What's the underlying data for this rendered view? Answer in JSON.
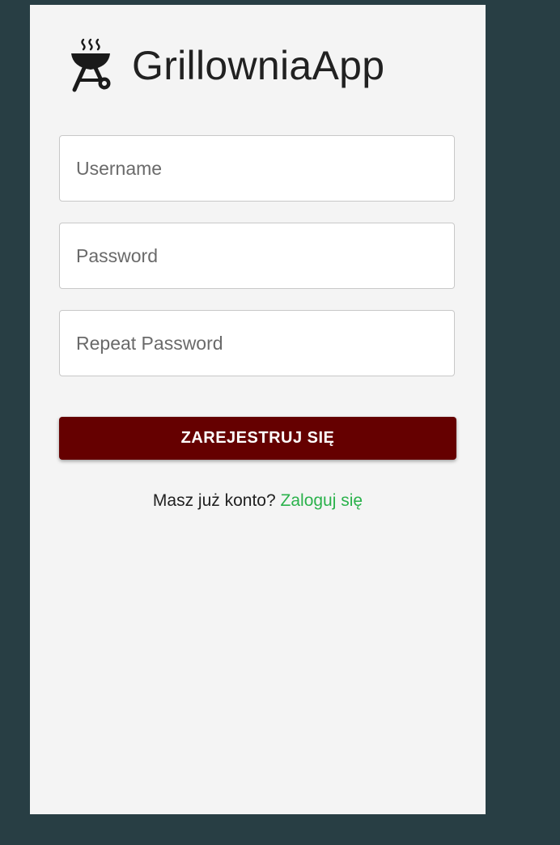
{
  "app": {
    "title": "GrillowniaApp",
    "logo_icon": "grill-icon"
  },
  "form": {
    "username_placeholder": "Username",
    "password_placeholder": "Password",
    "repeat_password_placeholder": "Repeat Password",
    "submit_label": "ZAREJESTRUJ SIĘ"
  },
  "footer": {
    "prompt": "Masz już konto?",
    "login_link": "Zaloguj się"
  },
  "colors": {
    "background": "#283e44",
    "panel": "#f4f4f4",
    "button": "#650000",
    "link": "#2bb24c"
  }
}
